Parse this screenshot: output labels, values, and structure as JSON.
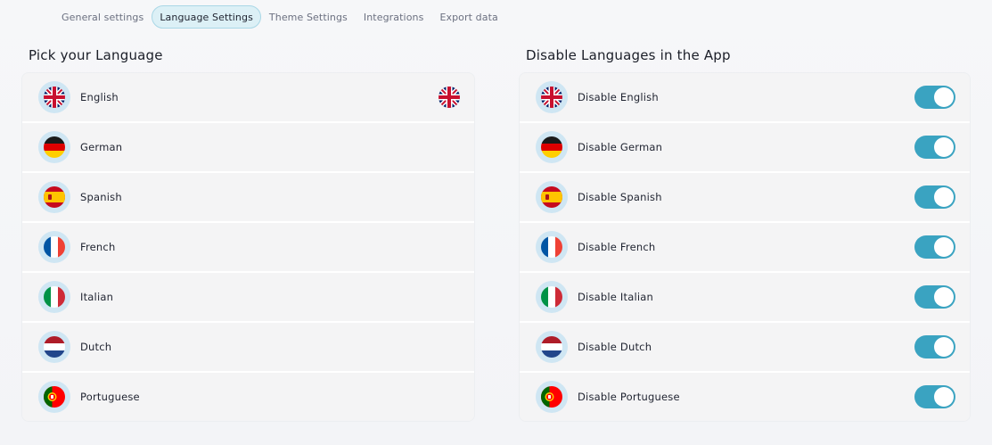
{
  "tabs": [
    {
      "label": "General settings",
      "active": false
    },
    {
      "label": "Language Settings",
      "active": true
    },
    {
      "label": "Theme Settings",
      "active": false
    },
    {
      "label": "Integrations",
      "active": false
    },
    {
      "label": "Export data",
      "active": false
    }
  ],
  "pick_language": {
    "title": "Pick your Language",
    "selected": "English",
    "selected_icon": "uk-flag-icon",
    "items": [
      {
        "label": "English",
        "icon": "uk-flag-icon"
      },
      {
        "label": "German",
        "icon": "germany-flag-icon"
      },
      {
        "label": "Spanish",
        "icon": "spain-flag-icon"
      },
      {
        "label": "French",
        "icon": "france-flag-icon"
      },
      {
        "label": "Italian",
        "icon": "italy-flag-icon"
      },
      {
        "label": "Dutch",
        "icon": "netherlands-flag-icon"
      },
      {
        "label": "Portuguese",
        "icon": "portugal-flag-icon"
      }
    ]
  },
  "disable_languages": {
    "title": "Disable Languages in the App",
    "items": [
      {
        "label": "Disable English",
        "icon": "uk-flag-icon",
        "enabled": true
      },
      {
        "label": "Disable German",
        "icon": "germany-flag-icon",
        "enabled": true
      },
      {
        "label": "Disable Spanish",
        "icon": "spain-flag-icon",
        "enabled": true
      },
      {
        "label": "Disable French",
        "icon": "france-flag-icon",
        "enabled": true
      },
      {
        "label": "Disable Italian",
        "icon": "italy-flag-icon",
        "enabled": true
      },
      {
        "label": "Disable Dutch",
        "icon": "netherlands-flag-icon",
        "enabled": true
      },
      {
        "label": "Disable Portuguese",
        "icon": "portugal-flag-icon",
        "enabled": true
      }
    ]
  },
  "colors": {
    "toggle_on": "#3aa3c1",
    "active_tab_bg": "#dcf0f6",
    "flag_ring": "#cfe6f3"
  }
}
